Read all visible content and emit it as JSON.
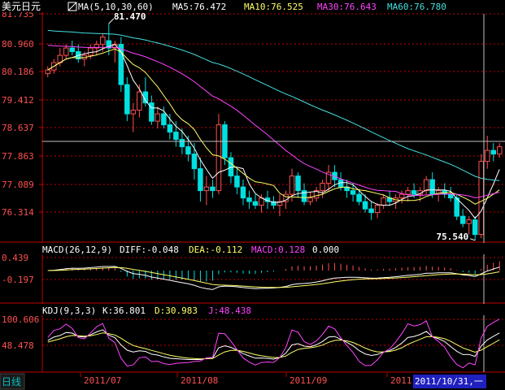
{
  "main_panel": {
    "symbol": "美元日元",
    "ma_label": "MA(5,10,30,60)",
    "ma5": "MA5:76.472",
    "ma10": "MA10:76.525",
    "ma30": "MA30:76.643",
    "ma60": "MA60:76.780",
    "price_ticks": [
      "81.735",
      "80.960",
      "80.186",
      "79.412",
      "78.637",
      "77.863",
      "77.089",
      "76.314"
    ],
    "high_marker": "81.470",
    "low_marker": "75.540"
  },
  "macd_panel": {
    "label": "MACD(26,12,9)",
    "diff": "DIFF:-0.048",
    "dea": "DEA:-0.112",
    "macd": "MACD:0.128",
    "extra": "0.000",
    "ticks": [
      "0.439",
      "-0.197"
    ]
  },
  "kdj_panel": {
    "label": "KDJ(9,3,3)",
    "k": "K:36.801",
    "d": "D:30.983",
    "j": "J:48.438",
    "ticks": [
      "100.606",
      "48.478"
    ]
  },
  "footer": {
    "period_tab": "日线",
    "dates": [
      "2011/07",
      "2011/08",
      "2011/09",
      "2011"
    ],
    "cursor_date": "2011/10/31,一"
  },
  "colors": {
    "up": "#ff5050",
    "down": "#00e0e0",
    "ma5": "#ffffff",
    "ma10": "#ffff66",
    "ma30": "#ff44ff",
    "ma60": "#44e0e0",
    "grid": "#c00000",
    "cursor_bg": "#2020c0"
  },
  "chart_data": {
    "type": "candlestick",
    "ylim": [
      75.4,
      81.8
    ],
    "macd_ylim": [
      -0.6,
      0.8
    ],
    "kdj_ylim": [
      -10,
      110
    ],
    "series": [
      {
        "name": "MA5",
        "values": []
      },
      {
        "name": "MA10",
        "values": []
      },
      {
        "name": "MA30",
        "values": []
      },
      {
        "name": "MA60",
        "values": []
      }
    ],
    "candles": [
      [
        80.1,
        80.3,
        80.0,
        80.2
      ],
      [
        80.2,
        80.5,
        80.1,
        80.4
      ],
      [
        80.4,
        80.8,
        80.3,
        80.6
      ],
      [
        80.6,
        80.9,
        80.5,
        80.8
      ],
      [
        80.8,
        81.0,
        80.6,
        80.7
      ],
      [
        80.7,
        80.9,
        80.4,
        80.5
      ],
      [
        80.5,
        80.7,
        80.3,
        80.6
      ],
      [
        80.6,
        80.9,
        80.5,
        80.8
      ],
      [
        80.8,
        81.0,
        80.6,
        80.9
      ],
      [
        80.9,
        81.2,
        80.7,
        81.1
      ],
      [
        81.0,
        81.47,
        80.6,
        80.8
      ],
      [
        80.8,
        81.0,
        80.4,
        80.9
      ],
      [
        80.9,
        81.1,
        79.6,
        79.8
      ],
      [
        79.8,
        80.0,
        78.8,
        79.0
      ],
      [
        79.0,
        79.3,
        78.5,
        79.1
      ],
      [
        79.1,
        79.8,
        78.9,
        79.6
      ],
      [
        79.6,
        80.0,
        79.2,
        79.3
      ],
      [
        79.3,
        79.5,
        78.7,
        78.8
      ],
      [
        78.8,
        79.2,
        78.6,
        79.0
      ],
      [
        79.0,
        79.2,
        78.6,
        78.7
      ],
      [
        78.7,
        79.0,
        78.3,
        78.5
      ],
      [
        78.5,
        78.8,
        78.1,
        78.3
      ],
      [
        78.3,
        78.6,
        77.9,
        78.1
      ],
      [
        78.1,
        78.4,
        77.7,
        77.9
      ],
      [
        77.9,
        78.2,
        77.2,
        77.5
      ],
      [
        77.5,
        77.8,
        76.6,
        76.9
      ],
      [
        76.9,
        77.3,
        76.5,
        77.0
      ],
      [
        77.0,
        77.2,
        76.7,
        76.9
      ],
      [
        76.9,
        79.0,
        76.8,
        78.7
      ],
      [
        78.7,
        78.8,
        77.6,
        77.8
      ],
      [
        77.8,
        77.95,
        77.1,
        77.3
      ],
      [
        77.3,
        77.5,
        76.8,
        77.0
      ],
      [
        77.0,
        77.2,
        76.5,
        76.7
      ],
      [
        76.7,
        76.9,
        76.4,
        76.6
      ],
      [
        76.6,
        76.8,
        76.4,
        76.5
      ],
      [
        76.5,
        76.8,
        76.3,
        76.7
      ],
      [
        76.7,
        76.9,
        76.4,
        76.6
      ],
      [
        76.6,
        76.75,
        76.4,
        76.5
      ],
      [
        76.5,
        76.8,
        76.2,
        76.6
      ],
      [
        76.6,
        76.9,
        76.4,
        76.8
      ],
      [
        76.8,
        77.5,
        76.6,
        77.3
      ],
      [
        77.3,
        77.4,
        76.7,
        76.9
      ],
      [
        76.9,
        77.1,
        76.5,
        76.6
      ],
      [
        76.6,
        76.85,
        76.5,
        76.7
      ],
      [
        76.7,
        77.0,
        76.6,
        76.9
      ],
      [
        76.9,
        77.2,
        76.7,
        77.1
      ],
      [
        77.1,
        77.6,
        76.9,
        77.4
      ],
      [
        77.4,
        77.6,
        77.0,
        77.2
      ],
      [
        77.2,
        77.4,
        76.9,
        77.0
      ],
      [
        77.0,
        77.2,
        76.7,
        76.9
      ],
      [
        76.9,
        77.1,
        76.6,
        76.8
      ],
      [
        76.8,
        76.95,
        76.5,
        76.6
      ],
      [
        76.6,
        76.8,
        76.3,
        76.4
      ],
      [
        76.4,
        76.6,
        76.1,
        76.3
      ],
      [
        76.3,
        76.55,
        76.15,
        76.5
      ],
      [
        76.5,
        76.8,
        76.4,
        76.7
      ],
      [
        76.7,
        76.9,
        76.5,
        76.6
      ],
      [
        76.6,
        76.8,
        76.4,
        76.7
      ],
      [
        76.7,
        76.9,
        76.55,
        76.8
      ],
      [
        76.8,
        77.0,
        76.6,
        76.9
      ],
      [
        76.9,
        77.1,
        76.7,
        76.8
      ],
      [
        76.8,
        77.0,
        76.6,
        76.9
      ],
      [
        76.9,
        77.3,
        76.8,
        77.2
      ],
      [
        77.2,
        77.4,
        76.7,
        76.8
      ],
      [
        76.8,
        77.0,
        76.6,
        76.9
      ],
      [
        76.9,
        77.1,
        76.7,
        76.8
      ],
      [
        76.8,
        77.0,
        76.6,
        76.7
      ],
      [
        76.7,
        76.8,
        76.1,
        76.2
      ],
      [
        76.2,
        76.4,
        75.9,
        76.0
      ],
      [
        76.0,
        76.2,
        75.7,
        76.1
      ],
      [
        76.1,
        76.2,
        75.54,
        75.7
      ],
      [
        75.7,
        77.9,
        75.6,
        77.7
      ],
      [
        77.7,
        78.4,
        77.5,
        78.0
      ],
      [
        78.0,
        78.2,
        77.7,
        77.9
      ],
      [
        77.9,
        78.2,
        77.8,
        78.1
      ]
    ]
  }
}
